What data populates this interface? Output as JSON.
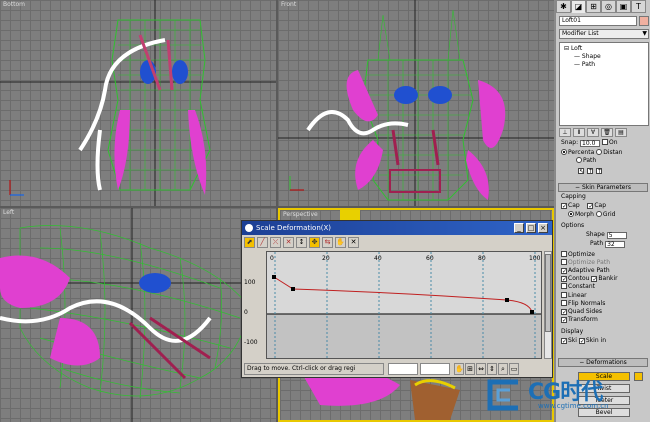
{
  "viewports": {
    "top": {
      "label": "Bottom"
    },
    "front": {
      "label": "Front"
    },
    "left": {
      "label": "Left"
    },
    "perspective": {
      "label": "Perspective"
    }
  },
  "command_panel": {
    "tabs": [
      {
        "icon": "create-icon",
        "glyph": "✱"
      },
      {
        "icon": "modify-icon",
        "glyph": "◪"
      },
      {
        "icon": "hierarchy-icon",
        "glyph": "⊞"
      },
      {
        "icon": "motion-icon",
        "glyph": "◎"
      },
      {
        "icon": "display-icon",
        "glyph": "▣"
      },
      {
        "icon": "utilities-icon",
        "glyph": "T"
      }
    ],
    "object_name": "Loft01",
    "object_color": "#f0b0a0",
    "modifier_list": "Modifier List",
    "stack": {
      "loft": "Loft",
      "shape": "Shape",
      "path": "Path"
    },
    "path_params": {
      "snap_label": "Snap:",
      "snap_value": "10.0",
      "on_label": "On",
      "percentage": "Percenta",
      "distance": "Distan",
      "path_steps": "Path"
    },
    "skin_params": {
      "header": "Skin Parameters",
      "capping": "Capping",
      "cap_start": "Cap",
      "cap_end": "Cap",
      "morph": "Morph",
      "grid": "Grid",
      "options": "Options",
      "shape_label": "Shape",
      "shape_value": "5",
      "path_label": "Path",
      "path_value": "32",
      "optimize1": "Optimize",
      "optimize2": "Optimize Path",
      "adaptive": "Adaptive Path",
      "contour": "Contou",
      "banking": "Bankir",
      "constant": "Constant",
      "linear": "Linear",
      "flip": "Flip Normals",
      "quad": "Quad Sides",
      "transform": "Transform",
      "display": "Display",
      "skin": "Ski",
      "skin_in": "Skin in"
    },
    "deformations": {
      "header": "Deformations",
      "scale": "Scale",
      "twist": "Twist",
      "teeter": "Teeter",
      "bevel": "Bevel"
    }
  },
  "dialog": {
    "title": "Scale Deformation(X)",
    "status": "Drag to move. Ctrl-click or drag regi",
    "y_ticks": [
      "100",
      "0",
      "-100"
    ],
    "x_ticks": [
      "0",
      "20",
      "40",
      "60",
      "80",
      "100"
    ],
    "tools": [
      "⬈",
      "╱",
      "⤫",
      "✕",
      "↕",
      "✥",
      "⇆",
      "✋",
      "✕"
    ],
    "status_icons": [
      "✋",
      "⊞",
      "⇔",
      "⇕",
      "⌕",
      "▭"
    ]
  },
  "watermark": {
    "brand": "CG时代",
    "url": "www.cgtime.com.cn"
  }
}
